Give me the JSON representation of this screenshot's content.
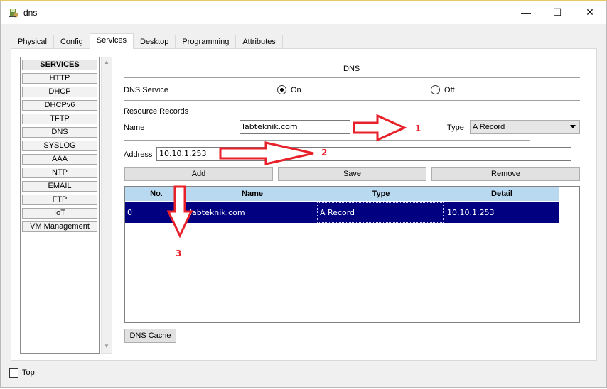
{
  "window": {
    "title": "dns",
    "controls": {
      "minimize": "—",
      "maximize": "☐",
      "close": "✕"
    }
  },
  "tabs": [
    "Physical",
    "Config",
    "Services",
    "Desktop",
    "Programming",
    "Attributes"
  ],
  "active_tab": "Services",
  "services": {
    "header": "SERVICES",
    "items": [
      "HTTP",
      "DHCP",
      "DHCPv6",
      "TFTP",
      "DNS",
      "SYSLOG",
      "AAA",
      "NTP",
      "EMAIL",
      "FTP",
      "IoT",
      "VM Management"
    ]
  },
  "dns": {
    "section_title": "DNS",
    "service_label": "DNS Service",
    "on_label": "On",
    "off_label": "Off",
    "service_state": "On",
    "resource_records_label": "Resource Records",
    "name_label": "Name",
    "name_value": "labteknik.com",
    "type_label": "Type",
    "type_value": "A Record",
    "address_label": "Address",
    "address_value": "10.10.1.253",
    "add_button": "Add",
    "save_button": "Save",
    "remove_button": "Remove",
    "table": {
      "headers": [
        "No.",
        "Name",
        "Type",
        "Detail"
      ],
      "rows": [
        {
          "no": "0",
          "name": "labteknik.com",
          "type": "A Record",
          "detail": "10.10.1.253"
        }
      ]
    },
    "cache_button": "DNS Cache"
  },
  "footer": {
    "top_label": "Top",
    "top_checked": false
  },
  "annotations": [
    "1",
    "2",
    "3"
  ],
  "colors": {
    "annotation": "#e8202a",
    "selected_row": "#000080",
    "table_header": "#b9d9f0"
  },
  "icons": [
    "app-icon",
    "minimize-icon",
    "maximize-icon",
    "close-icon",
    "dropdown-arrow-icon",
    "scroll-up-icon",
    "scroll-down-icon"
  ]
}
